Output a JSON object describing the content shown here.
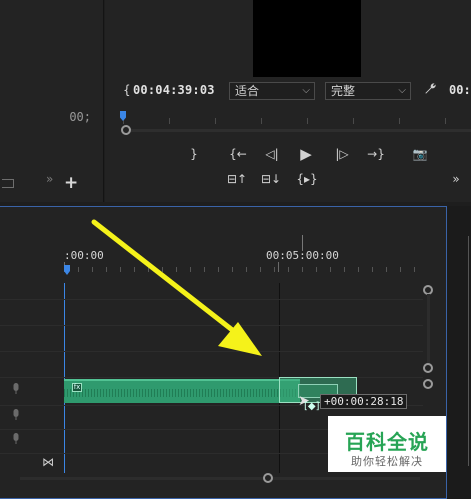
{
  "project_panel": {
    "frame_timecode": "00;",
    "chevron_glyph": "»",
    "add_glyph": "+"
  },
  "monitor": {
    "bracket_glyph": "{",
    "timecode": "00:04:39:03",
    "fit_dropdown": {
      "value": "适合"
    },
    "quality_dropdown": {
      "value": "完整"
    },
    "wrench_glyph": "🔧",
    "right_timecode": "00:",
    "transport_row1": [
      "}",
      "{←",
      "◁|",
      "▶",
      "|▷",
      "→}",
      "📷"
    ],
    "transport_row2": [
      "⊟↑",
      "⊟↓",
      "{▸}"
    ],
    "more_glyph": "»"
  },
  "timeline": {
    "ruler_start_label": ":00:00",
    "ruler_mid_label": "00:05:00:00",
    "drag_timecode": "+00:00:28:18",
    "clip_badge": "fx",
    "track_mic_glyph": "🎙",
    "bowtie_glyph": "⋈"
  },
  "watermark": {
    "title": "百科全说",
    "subtitle": "助你轻松解决"
  },
  "colors": {
    "clip_green": "#2f9a6e",
    "playhead_blue": "#3b86e6",
    "arrow_yellow": "#f5f21a",
    "watermark_green": "#27a455"
  }
}
